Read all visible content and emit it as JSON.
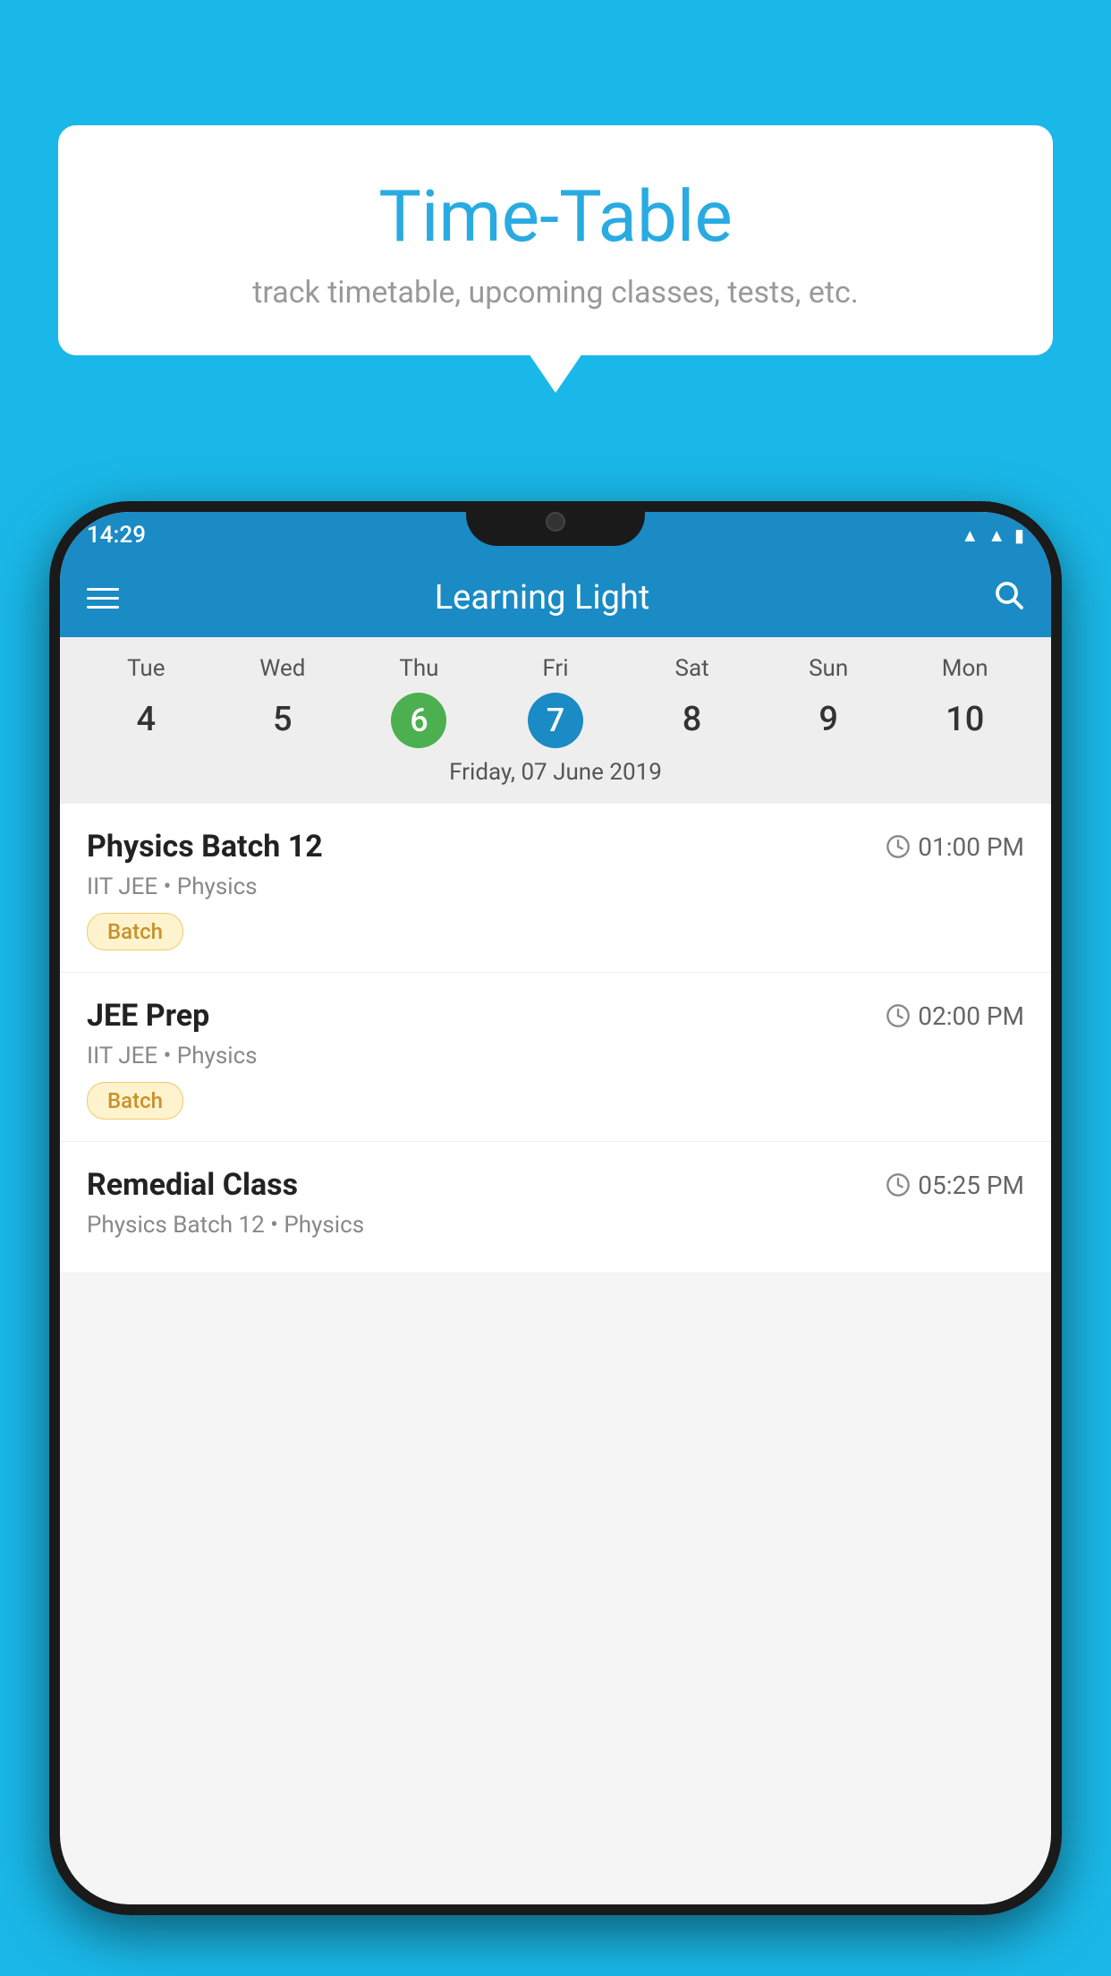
{
  "background_color": "#1ab8e8",
  "speech_bubble": {
    "title": "Time-Table",
    "subtitle": "track timetable, upcoming classes, tests, etc."
  },
  "status_bar": {
    "time": "14:29"
  },
  "app_bar": {
    "title": "Learning Light"
  },
  "calendar": {
    "days": [
      {
        "label": "Tue",
        "number": "4"
      },
      {
        "label": "Wed",
        "number": "5"
      },
      {
        "label": "Thu",
        "number": "6",
        "state": "today"
      },
      {
        "label": "Fri",
        "number": "7",
        "state": "selected"
      },
      {
        "label": "Sat",
        "number": "8"
      },
      {
        "label": "Sun",
        "number": "9"
      },
      {
        "label": "Mon",
        "number": "10"
      }
    ],
    "selected_date_label": "Friday, 07 June 2019"
  },
  "classes": [
    {
      "name": "Physics Batch 12",
      "time": "01:00 PM",
      "meta": "IIT JEE • Physics",
      "tag": "Batch"
    },
    {
      "name": "JEE Prep",
      "time": "02:00 PM",
      "meta": "IIT JEE • Physics",
      "tag": "Batch"
    },
    {
      "name": "Remedial Class",
      "time": "05:25 PM",
      "meta": "Physics Batch 12 • Physics",
      "tag": ""
    }
  ]
}
